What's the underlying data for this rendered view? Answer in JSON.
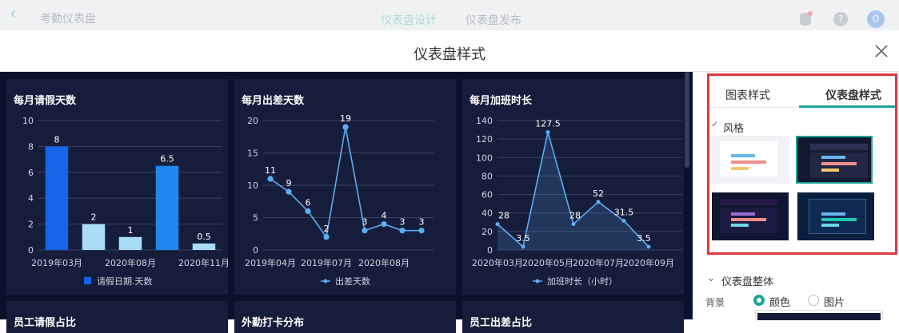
{
  "topbar": {
    "back_icon": "chevron-left-icon",
    "title": "考勤仪表盘",
    "tabs": [
      "仪表盘设计",
      "仪表盘发布"
    ],
    "avatar_text": "O"
  },
  "modal": {
    "title": "仪表盘样式",
    "close_icon": "close-icon"
  },
  "cards": [
    {
      "title": "每月请假天数"
    },
    {
      "title": "每月出差天数"
    },
    {
      "title": "每月加班时长"
    },
    {
      "title": "员工请假占比"
    },
    {
      "title": "外勤打卡分布"
    },
    {
      "title": "员工出差占比"
    }
  ],
  "chart_data": [
    {
      "type": "bar",
      "title": "每月请假天数",
      "categories": [
        "2019年03月",
        "",
        "2020年08月",
        "",
        "2020年11月"
      ],
      "tick_labels": [
        "2019年03月",
        "2020年08月",
        "2020年11月"
      ],
      "values": [
        8,
        2,
        1,
        6.5,
        0.5
      ],
      "data_labels": [
        "8",
        "2",
        "1",
        "6.5",
        "0.5"
      ],
      "yticks": [
        "0",
        "2",
        "4",
        "6",
        "8",
        "10"
      ],
      "ylim": [
        0,
        10
      ],
      "legend": "请假日期.天数",
      "colors": [
        "#1565e8",
        "#a8dcf7",
        "#a8dcf7",
        "#1e88f0",
        "#a8dcf7"
      ]
    },
    {
      "type": "line",
      "title": "每月出差天数",
      "values": [
        11,
        9,
        6,
        2,
        19,
        3,
        4,
        3,
        3
      ],
      "data_labels": [
        "11",
        "9",
        "6",
        "2",
        "19",
        "3",
        "4",
        "3",
        "3"
      ],
      "tick_labels": [
        "2019年04月",
        "2019年07月",
        "2020年08月"
      ],
      "yticks": [
        "0",
        "5",
        "10",
        "15",
        "20"
      ],
      "ylim": [
        0,
        20
      ],
      "legend": "出差天数",
      "color": "#5aaef5"
    },
    {
      "type": "area",
      "title": "每月加班时长",
      "values": [
        28,
        3.5,
        127.5,
        28,
        52,
        31.5,
        3.5
      ],
      "data_labels": [
        "28",
        "3.5",
        "127.5",
        "28",
        "52",
        "31.5",
        "3.5"
      ],
      "tick_labels": [
        "2020年03月",
        "2020年05月",
        "2020年07月",
        "2020年09月"
      ],
      "yticks": [
        "0",
        "20",
        "40",
        "60",
        "80",
        "100",
        "120",
        "140"
      ],
      "ylim": [
        0,
        140
      ],
      "legend": "加班时长（小时）",
      "color": "#5aaef5"
    }
  ],
  "panel": {
    "tabs": [
      "图表样式",
      "仪表盘样式"
    ],
    "active_tab": "仪表盘样式",
    "style_section": "风格",
    "whole_section": "仪表盘整体",
    "background_label": "背景",
    "background_options": [
      "颜色",
      "图片"
    ],
    "background_selected": "颜色",
    "accent_color": "#1ea59a"
  }
}
